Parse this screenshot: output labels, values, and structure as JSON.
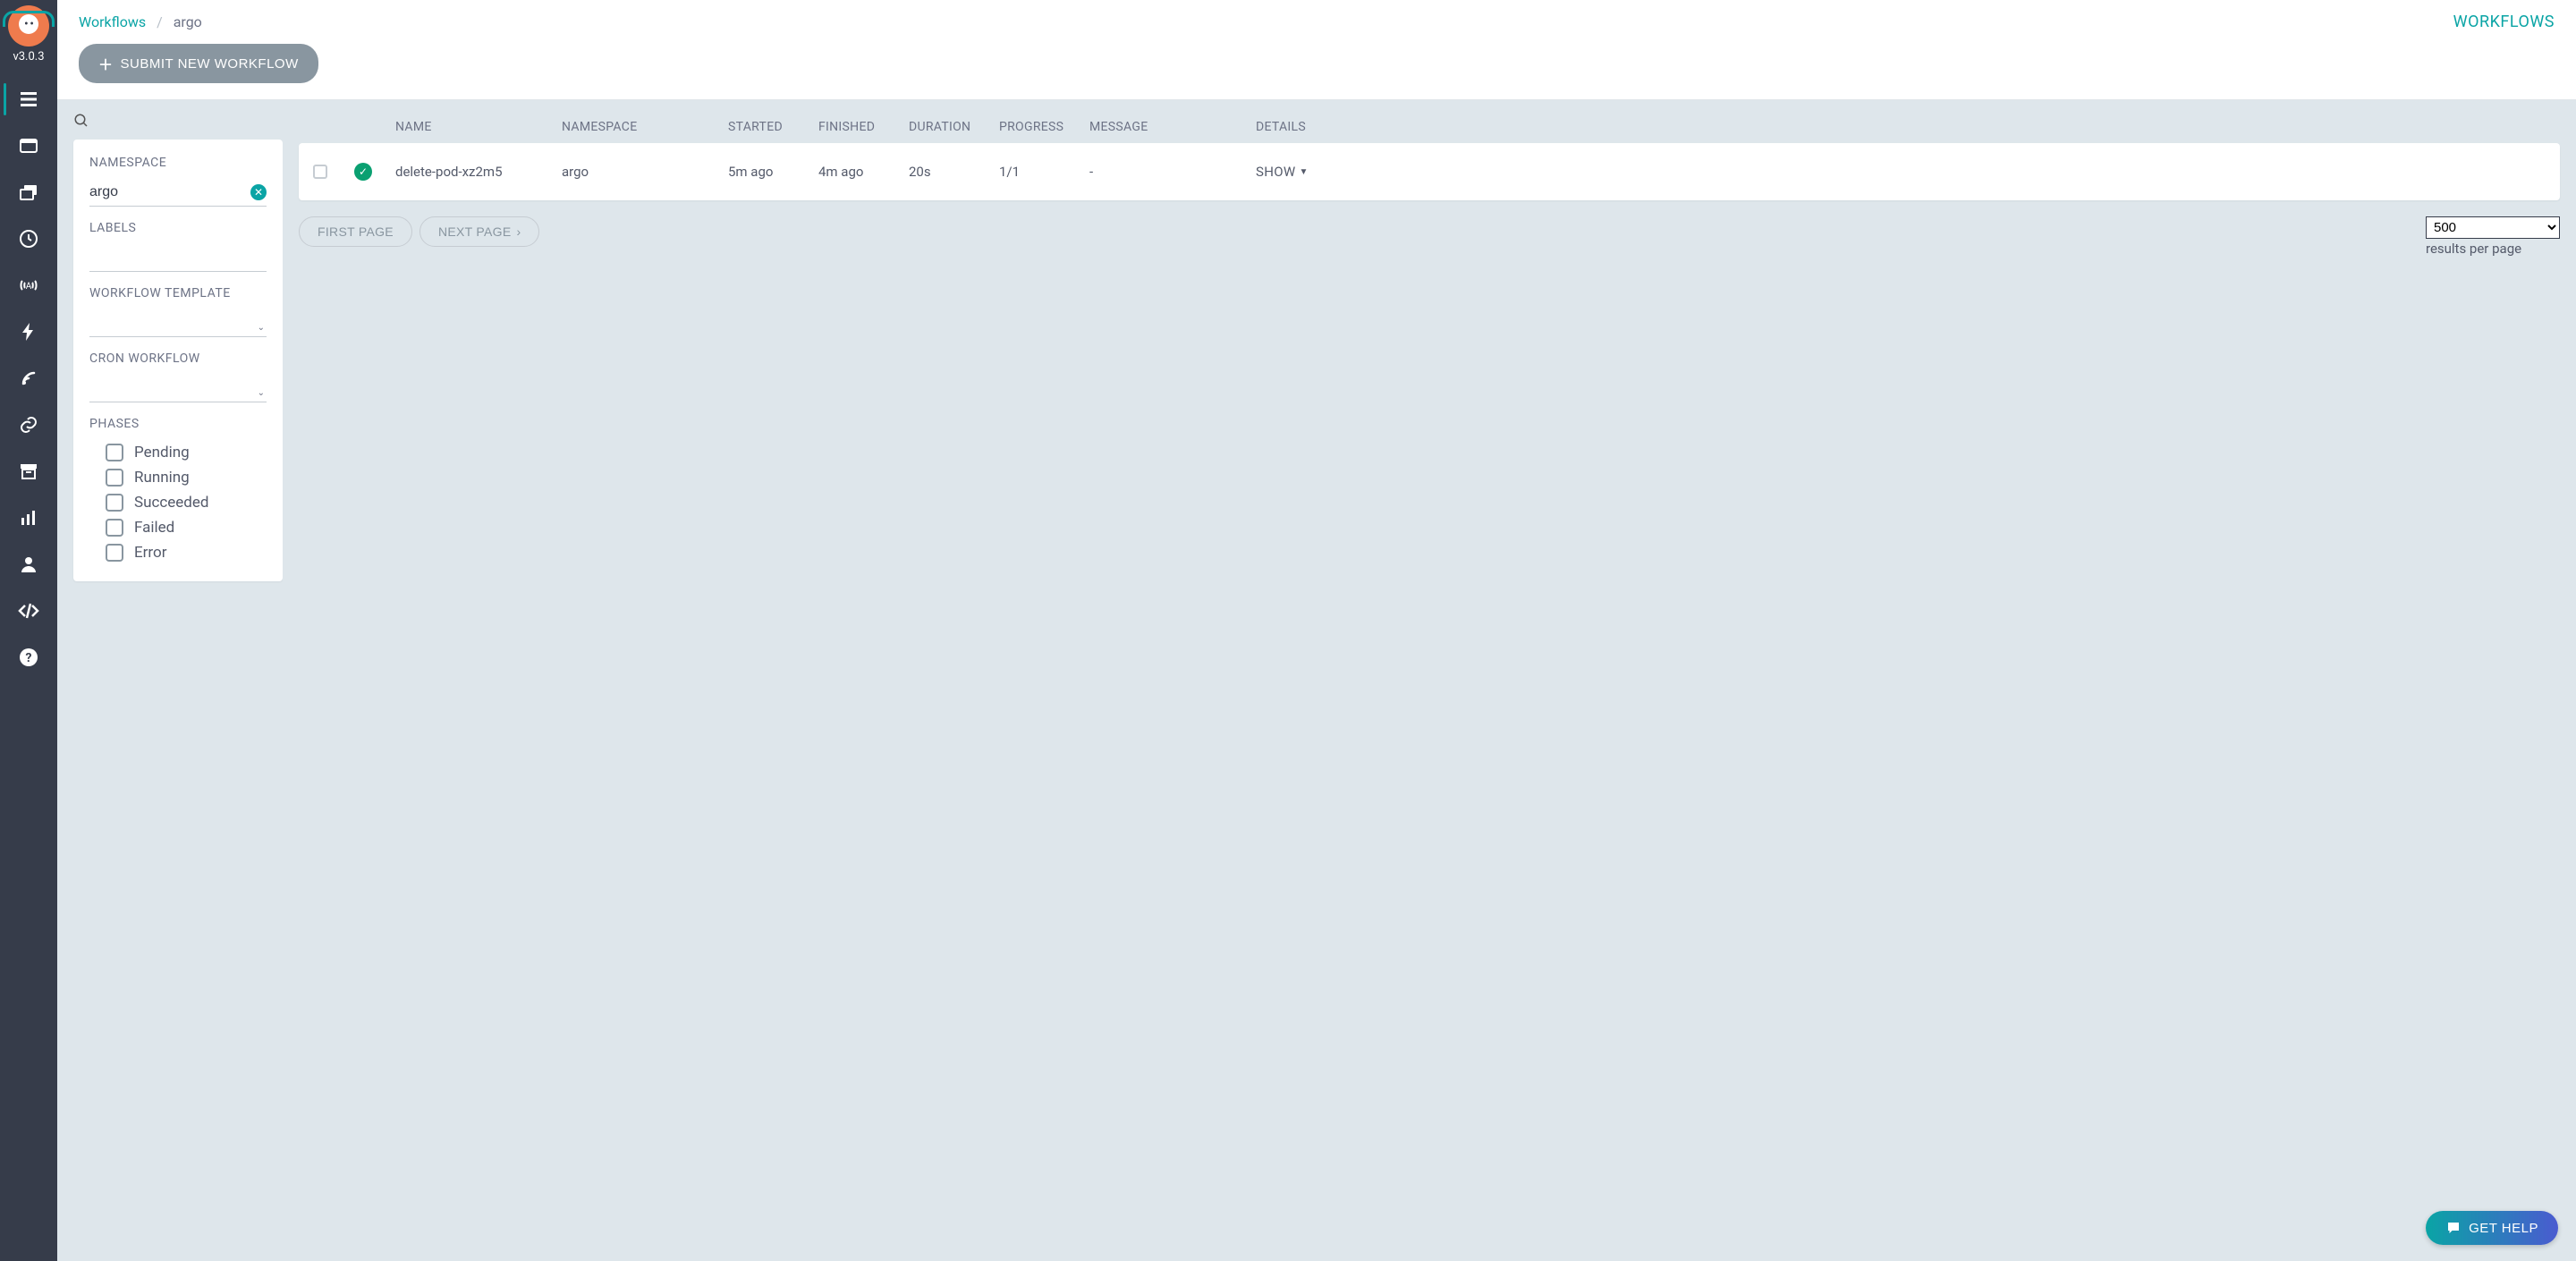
{
  "version": "v3.0.3",
  "breadcrumb": {
    "root": "Workflows",
    "current": "argo"
  },
  "top_right": "WORKFLOWS",
  "submit_btn": "SUBMIT NEW WORKFLOW",
  "filters": {
    "namespace_label": "NAMESPACE",
    "namespace_value": "argo",
    "labels_label": "LABELS",
    "labels_value": "",
    "wft_label": "WORKFLOW TEMPLATE",
    "wft_value": "",
    "cron_label": "CRON WORKFLOW",
    "cron_value": "",
    "phases_label": "PHASES",
    "phases": [
      "Pending",
      "Running",
      "Succeeded",
      "Failed",
      "Error"
    ]
  },
  "table": {
    "headers": {
      "name": "NAME",
      "namespace": "NAMESPACE",
      "started": "STARTED",
      "finished": "FINISHED",
      "duration": "DURATION",
      "progress": "PROGRESS",
      "message": "MESSAGE",
      "details": "DETAILS"
    },
    "rows": [
      {
        "name": "delete-pod-xz2m5",
        "namespace": "argo",
        "started": "5m ago",
        "finished": "4m ago",
        "duration": "20s",
        "progress": "1/1",
        "message": "-",
        "details": "SHOW"
      }
    ]
  },
  "pagination": {
    "first": "FIRST PAGE",
    "next": "NEXT PAGE",
    "per_page_options": [
      "500"
    ],
    "per_page_selected": "500",
    "per_page_label": "results per page"
  },
  "help": "GET HELP"
}
